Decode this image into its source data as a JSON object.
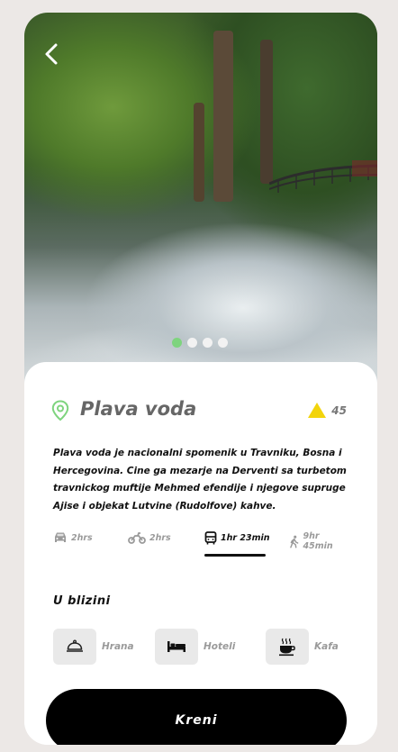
{
  "gallery": {
    "total_dots": 4,
    "active_dot": 1
  },
  "place": {
    "title": "Plava voda",
    "rating": "45",
    "description": "Plava voda je nacionalni spomenik u Travniku, Bosna i Hercegovina. Cine ga mezarje na Derventi sa turbetom travnickog muftije Mehmed efendije i njegove supruge Ajise i objekat Lutvine (Rudolfove) kahve."
  },
  "transport": {
    "car": "2hrs",
    "bike": "2hrs",
    "bus": "1hr 23min",
    "walk": "9hr 45min",
    "active": "bus"
  },
  "nearby": {
    "title": "U blizini",
    "items": [
      {
        "label": "Hrana",
        "icon": "cloche-icon"
      },
      {
        "label": "Hoteli",
        "icon": "bed-icon"
      },
      {
        "label": "Kafa",
        "icon": "coffee-cup-icon"
      }
    ]
  },
  "action": {
    "go_label": "Kreni"
  },
  "colors": {
    "accent": "#7ed47e",
    "rating": "#f2d40c",
    "button": "#000000"
  }
}
